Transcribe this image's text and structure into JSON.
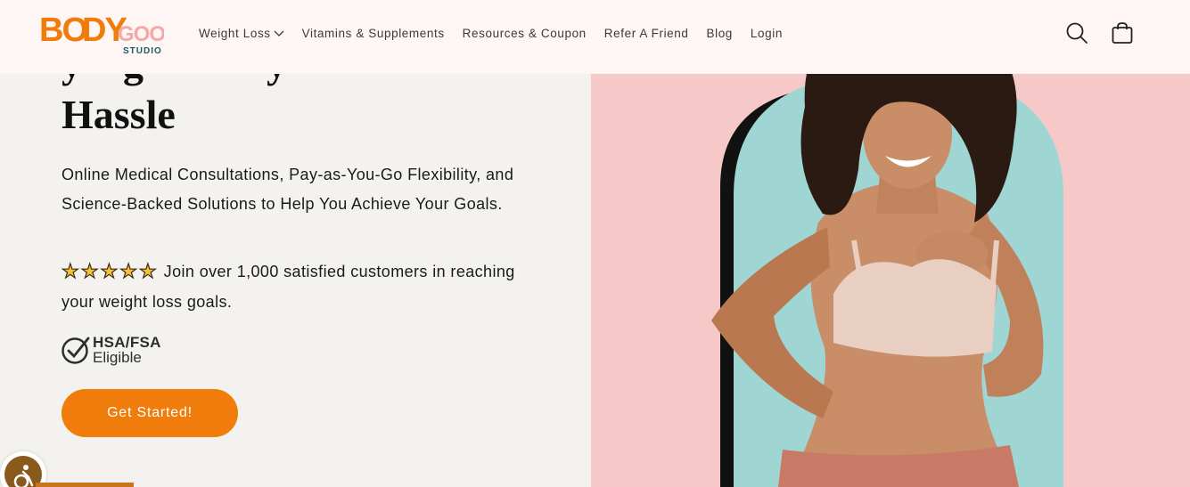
{
  "brand": {
    "logo_text_top": "BODY GOOD",
    "logo_text_bottom": "STUDIO"
  },
  "nav": {
    "items": [
      {
        "label": "Weight Loss",
        "has_dropdown": true
      },
      {
        "label": "Vitamins & Supplements"
      },
      {
        "label": "Resources & Coupon"
      },
      {
        "label": "Refer A Friend"
      },
      {
        "label": "Blog"
      },
      {
        "label": "Login"
      }
    ],
    "icons": [
      "search-icon",
      "cart-icon"
    ]
  },
  "hero": {
    "headline": "Hassle",
    "subtext": "Online Medical Consultations, Pay-as-You-Go Flexibility, and Science-Backed Solutions to Help You Achieve Your Goals.",
    "rating_stars": 5,
    "rating_text": "Join over 1,000 satisfied customers in reaching your weight loss goals.",
    "hsa_line1": "HSA/FSA",
    "hsa_line2": "Eligible",
    "cta_label": "Get Started!"
  },
  "colors": {
    "accent": "#f07c0c",
    "header_bg": "#fdf6f5",
    "left_bg": "#f3f2ef",
    "right_bg": "#f6c8c8",
    "arch_teal": "#9fd6d4"
  }
}
